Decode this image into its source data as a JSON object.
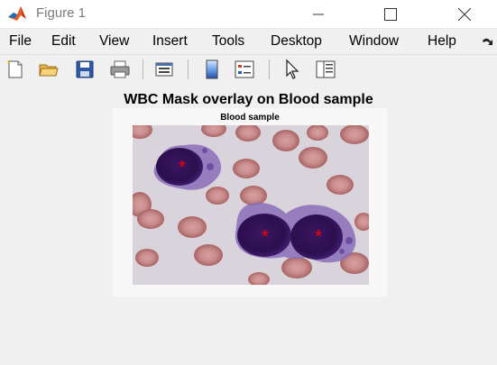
{
  "window": {
    "title": "Figure 1",
    "app_icon": "matlab-icon",
    "controls": [
      "minimize-icon",
      "maximize-icon",
      "close-icon"
    ]
  },
  "menu": {
    "items": [
      "File",
      "Edit",
      "View",
      "Insert",
      "Tools",
      "Desktop",
      "Window",
      "Help"
    ],
    "overflow_icon": "dock-arrow-icon"
  },
  "toolbar": {
    "buttons": [
      "new-figure-icon",
      "open-file-icon",
      "save-icon",
      "print-icon",
      "link-plot-icon",
      "colorbar-icon",
      "legend-icon",
      "edit-plot-icon",
      "property-inspector-icon"
    ]
  },
  "figure": {
    "title": "WBC Mask overlay on Blood sample",
    "axes_title": "Blood sample",
    "marker": "*",
    "marker_color": "#ff0000",
    "marker_count": 3
  }
}
